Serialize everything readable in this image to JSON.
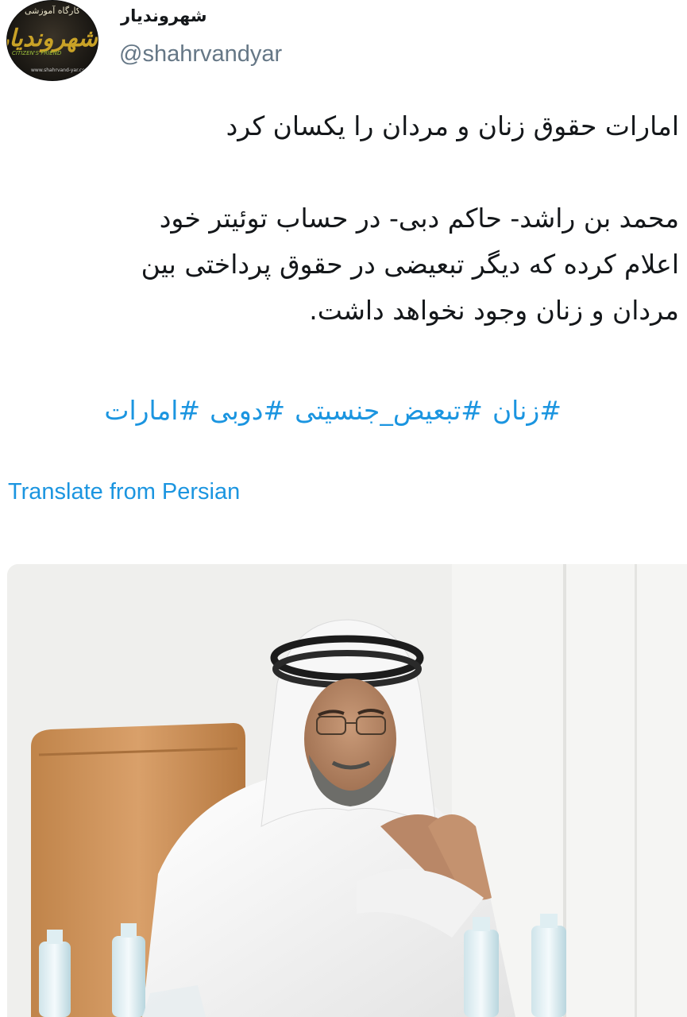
{
  "author": {
    "display_name": "شهروندیار",
    "handle": "@shahrvandyar",
    "avatar": {
      "top_text": "کارگاه آموزشی",
      "logo_text": "شهروندیار",
      "sub_text": "CITIZEN'S FRIEND",
      "url_text": "www.shahrvand-yar.com"
    }
  },
  "tweet": {
    "title": "امارات حقوق زنان و مردان را یکسان کرد",
    "body_lines": [
      "محمد بن راشد- حاکم دبی- در حساب توئیتر خود",
      "اعلام کرده که دیگر تبعیضی در حقوق پرداختی بین",
      "مردان و زنان وجود نخواهد داشت."
    ],
    "hashtags": [
      "#زنان",
      "#تبعیض_جنسیتی",
      "#دوبی",
      "#امارات"
    ],
    "translate_label": "Translate from Persian"
  },
  "colors": {
    "link": "#1b95e0",
    "handle": "#657786",
    "text": "#14171a"
  }
}
